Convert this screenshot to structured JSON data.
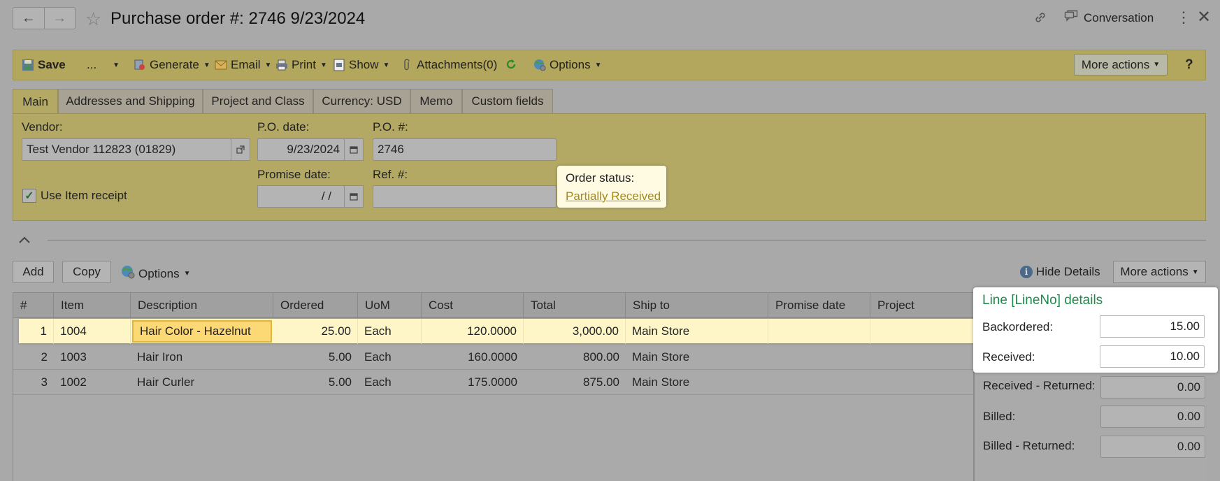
{
  "header": {
    "title": "Purchase order #: 2746 9/23/2024",
    "back_icon": "←",
    "forward_icon": "→",
    "star_icon": "☆",
    "link_icon": "🔗",
    "conversation_label": "Conversation",
    "more_icon": "⋮",
    "close_icon": "✕"
  },
  "toolbar": {
    "save_label": "Save",
    "dots_label": "...",
    "generate_label": "Generate",
    "email_label": "Email",
    "print_label": "Print",
    "show_label": "Show",
    "attachments_label": "Attachments(0)",
    "options_label": "Options",
    "more_actions_label": "More actions",
    "help_label": "?"
  },
  "tabs": [
    {
      "label": "Main",
      "active": true
    },
    {
      "label": "Addresses and Shipping"
    },
    {
      "label": "Project and Class"
    },
    {
      "label": "Currency: USD"
    },
    {
      "label": "Memo"
    },
    {
      "label": "Custom fields"
    }
  ],
  "form": {
    "vendor_label": "Vendor:",
    "vendor_value": "Test Vendor 112823 (01829)",
    "po_date_label": "P.O. date:",
    "po_date_value": "9/23/2024",
    "po_number_label": "P.O. #:",
    "po_number_value": "2746",
    "promise_date_label": "Promise date:",
    "promise_date_value": "/  /",
    "ref_label": "Ref. #:",
    "ref_value": "",
    "use_item_receipt_label": "Use Item receipt",
    "use_item_receipt_checked": true,
    "order_status_label": "Order status:",
    "order_status_value": "Partially Received"
  },
  "grid_toolbar": {
    "add_label": "Add",
    "copy_label": "Copy",
    "options_label": "Options",
    "hide_details_label": "Hide Details",
    "more_actions_label": "More actions"
  },
  "grid": {
    "columns": [
      "#",
      "Item",
      "Description",
      "Ordered",
      "UoM",
      "Cost",
      "Total",
      "Ship to",
      "Promise date",
      "Project"
    ],
    "rows": [
      {
        "num": "1",
        "item": "1004",
        "description": "Hair Color - Hazelnut",
        "ordered": "25.00",
        "uom": "Each",
        "cost": "120.0000",
        "total": "3,000.00",
        "ship_to": "Main Store",
        "promise_date": "",
        "project": ""
      },
      {
        "num": "2",
        "item": "1003",
        "description": "Hair Iron",
        "ordered": "5.00",
        "uom": "Each",
        "cost": "160.0000",
        "total": "800.00",
        "ship_to": "Main Store",
        "promise_date": "",
        "project": ""
      },
      {
        "num": "3",
        "item": "1002",
        "description": "Hair Curler",
        "ordered": "5.00",
        "uom": "Each",
        "cost": "175.0000",
        "total": "875.00",
        "ship_to": "Main Store",
        "promise_date": "",
        "project": ""
      }
    ]
  },
  "details": {
    "title": "Line [LineNo] details",
    "backordered_label": "Backordered:",
    "backordered_value": "15.00",
    "received_label": "Received:",
    "received_value": "10.00",
    "received_returned_label": "Received - Returned:",
    "received_returned_value": "0.00",
    "billed_label": "Billed:",
    "billed_value": "0.00",
    "billed_returned_label": "Billed - Returned:",
    "billed_returned_value": "0.00"
  },
  "colors": {
    "toolbar_bg": "#b3a65d",
    "status_link": "#a58a1a",
    "details_title": "#1f8a4c",
    "selected_row": "#fff6c8"
  }
}
